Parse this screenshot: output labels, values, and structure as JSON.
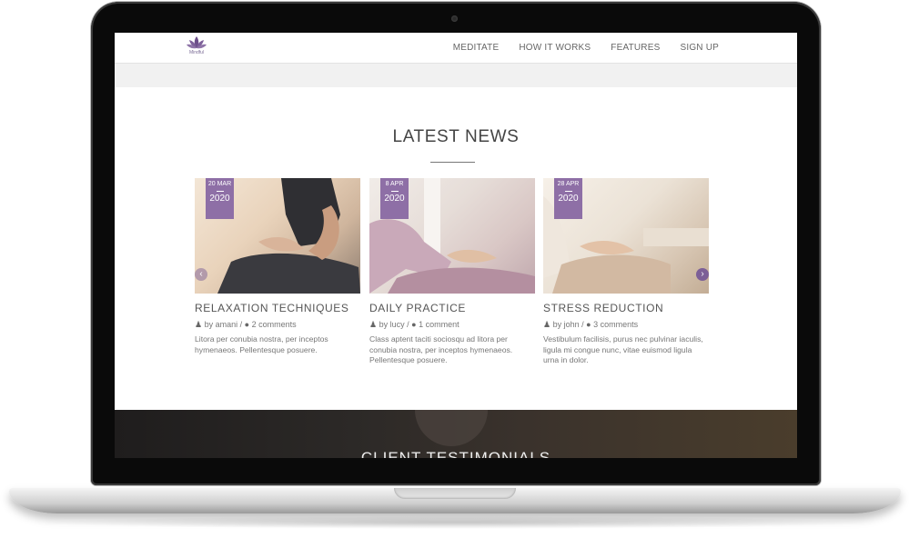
{
  "nav": {
    "logo_text": "Mindful",
    "links": [
      "MEDITATE",
      "HOW IT WORKS",
      "FEATURES",
      "SIGN UP"
    ]
  },
  "news": {
    "title": "LATEST NEWS",
    "cards": [
      {
        "date_day": "20 MAR",
        "date_year": "2020",
        "title": "RELAXATION TECHNIQUES",
        "author": "by amani /",
        "comments": "2 comments",
        "excerpt": "Litora per conubia nostra, per inceptos hymenaeos. Pellentesque posuere."
      },
      {
        "date_day": "8 APR",
        "date_year": "2020",
        "title": "DAILY PRACTICE",
        "author": "by lucy /",
        "comments": "1 comment",
        "excerpt": "Class aptent taciti sociosqu ad litora per conubia nostra, per inceptos hymenaeos. Pellentesque posuere."
      },
      {
        "date_day": "28 APR",
        "date_year": "2020",
        "title": "STRESS REDUCTION",
        "author": "by john /",
        "comments": "3 comments",
        "excerpt": "Vestibulum facilisis, purus nec pulvinar iaculis, ligula mi congue nunc, vitae euismod ligula urna in dolor."
      }
    ]
  },
  "testimonials": {
    "title": "CLIENT TESTIMONIALS"
  },
  "colors": {
    "accent": "#8e6fa6",
    "dark_section": "#2c2927"
  },
  "icons": [
    "lotus-logo-icon",
    "user-icon",
    "comment-icon",
    "chevron-left-icon",
    "chevron-right-icon"
  ]
}
